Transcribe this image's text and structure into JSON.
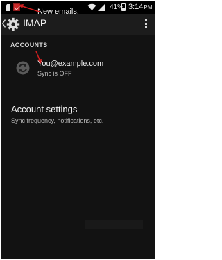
{
  "status_bar": {
    "battery_percent_text": "41%",
    "battery_level": 0.41,
    "time": "3:14",
    "time_suffix": "PM",
    "icons": [
      "sim-card-icon",
      "new-email-icon",
      "wifi-icon",
      "signal-icon",
      "battery-icon"
    ]
  },
  "annotation": {
    "new_emails_text": "New emails.",
    "color": "#d41f1f"
  },
  "action_bar": {
    "title": "IMAP",
    "icons": [
      "back-icon",
      "settings-gear-icon",
      "overflow-menu-icon"
    ]
  },
  "accounts_section": {
    "header": "ACCOUNTS",
    "items": [
      {
        "email": "You@example.com",
        "status": "Sync is OFF",
        "icon": "sync-off-icon"
      }
    ]
  },
  "account_settings": {
    "title": "Account settings",
    "subtitle": "Sync frequency, notifications, etc."
  },
  "colors": {
    "background": "#121212",
    "action_bar": "#1c1c1c",
    "primary_text": "#f0f0f0",
    "secondary_text": "#b8b8b8",
    "annotation_red": "#d41f1f"
  }
}
